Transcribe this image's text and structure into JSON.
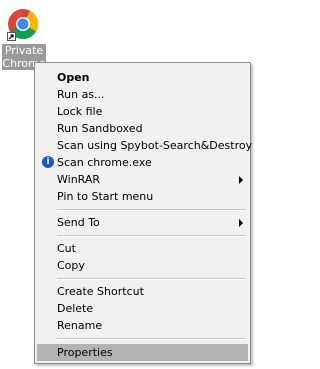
{
  "desktop": {
    "icon_label_line1": "Private",
    "icon_label_line2": "Chrome",
    "icon": "chrome-icon"
  },
  "menu": {
    "open": "Open",
    "run_as": "Run as...",
    "lock_file": "Lock file",
    "run_sandboxed": "Run Sandboxed",
    "scan_spybot": "Scan using Spybot-Search&Destroy",
    "scan_chrome": "Scan chrome.exe",
    "winrar": "WinRAR",
    "pin_start": "Pin to Start menu",
    "send_to": "Send To",
    "cut": "Cut",
    "copy": "Copy",
    "create_shortcut": "Create Shortcut",
    "delete": "Delete",
    "rename": "Rename",
    "properties": "Properties"
  },
  "colors": {
    "menu_bg": "#f1f1f1",
    "highlight": "#b3b3b3",
    "label_bg": "#9a9a9a",
    "info_icon": "#1f56c4"
  }
}
